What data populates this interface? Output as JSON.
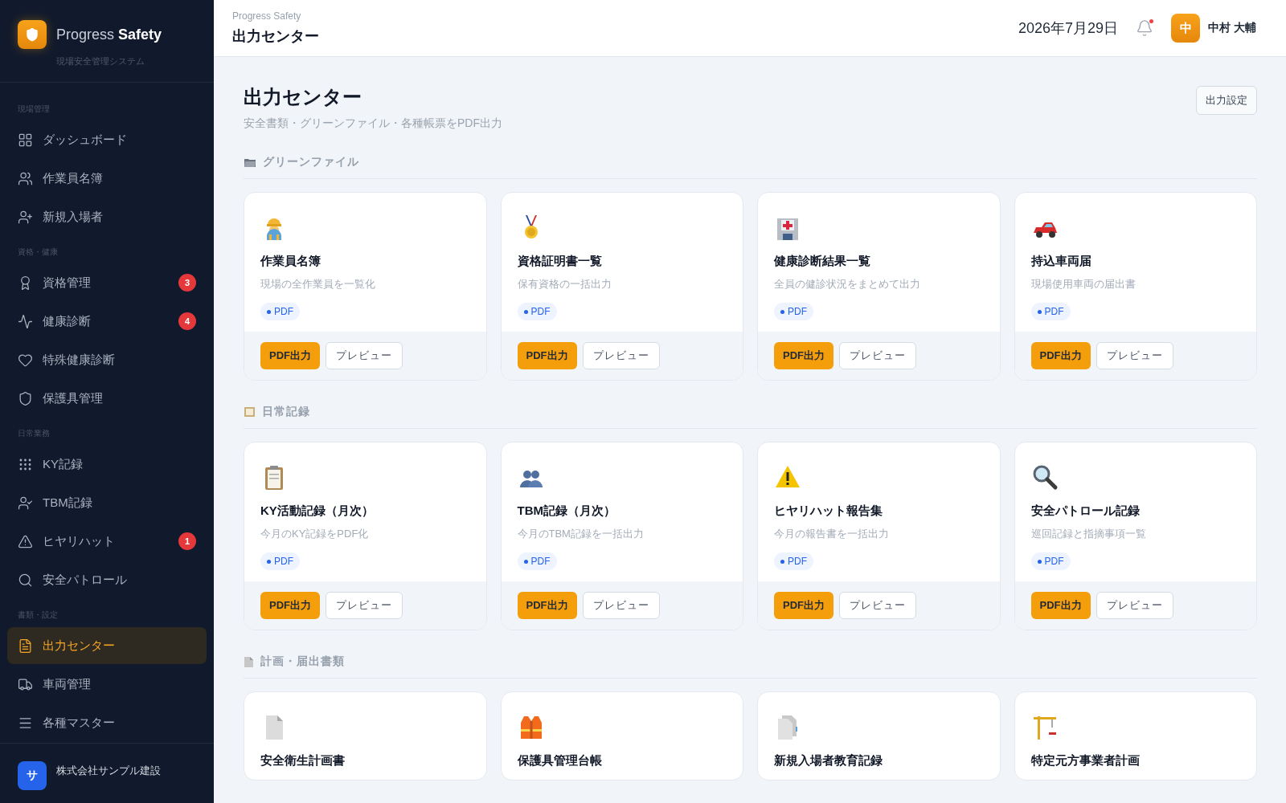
{
  "sidebar": {
    "brand": {
      "name_light": "Progress",
      "name_bold": "Safety",
      "tagline": "現場安全管理システム"
    },
    "groups": [
      {
        "label": "現場管理",
        "items": [
          {
            "label": "ダッシュボード",
            "selected": false
          },
          {
            "label": "作業員名簿",
            "selected": false
          },
          {
            "label": "新規入場者",
            "selected": false
          }
        ]
      },
      {
        "label": "資格・健康",
        "items": [
          {
            "label": "資格管理",
            "selected": false,
            "badge": "3"
          },
          {
            "label": "健康診断",
            "selected": false,
            "badge": "4"
          },
          {
            "label": "特殊健康診断",
            "selected": false
          },
          {
            "label": "保護具管理",
            "selected": false
          }
        ]
      },
      {
        "label": "日常業務",
        "items": [
          {
            "label": "KY記録",
            "selected": false
          },
          {
            "label": "TBM記録",
            "selected": false
          },
          {
            "label": "ヒヤリハット",
            "selected": false,
            "badge": "1"
          },
          {
            "label": "安全パトロール",
            "selected": false
          }
        ]
      },
      {
        "label": "書類・設定",
        "items": [
          {
            "label": "出力センター",
            "selected": true
          },
          {
            "label": "車両管理",
            "selected": false
          },
          {
            "label": "各種マスター",
            "selected": false
          }
        ]
      }
    ],
    "company": {
      "avatar": "サ",
      "name": "株式会社サンプル建設"
    }
  },
  "header": {
    "breadcrumb": "Progress Safety",
    "title": "出力センター",
    "date": "2026年7月29日",
    "notification": true,
    "user": {
      "avatar": "中",
      "name": "中村 大輔"
    }
  },
  "page": {
    "title": "出力センター",
    "subtitle": "安全書類・グリーンファイル・各種帳票をPDF出力",
    "settings_button": "出力設定"
  },
  "sections": [
    {
      "title": "グリーンファイル",
      "cards": [
        {
          "title": "作業員名簿",
          "description": "現場の全作業員を一覧化",
          "format": "PDF",
          "primary": "PDF出力",
          "secondary": "プレビュー"
        },
        {
          "title": "資格証明書一覧",
          "description": "保有資格の一括出力",
          "format": "PDF",
          "primary": "PDF出力",
          "secondary": "プレビュー"
        },
        {
          "title": "健康診断結果一覧",
          "description": "全員の健診状況をまとめて出力",
          "format": "PDF",
          "primary": "PDF出力",
          "secondary": "プレビュー"
        },
        {
          "title": "持込車両届",
          "description": "現場使用車両の届出書",
          "format": "PDF",
          "primary": "PDF出力",
          "secondary": "プレビュー"
        }
      ]
    },
    {
      "title": "日常記録",
      "cards": [
        {
          "title": "KY活動記録（月次）",
          "description": "今月のKY記録をPDF化",
          "format": "PDF",
          "primary": "PDF出力",
          "secondary": "プレビュー"
        },
        {
          "title": "TBM記録（月次）",
          "description": "今月のTBM記録を一括出力",
          "format": "PDF",
          "primary": "PDF出力",
          "secondary": "プレビュー"
        },
        {
          "title": "ヒヤリハット報告集",
          "description": "今月の報告書を一括出力",
          "format": "PDF",
          "primary": "PDF出力",
          "secondary": "プレビュー"
        },
        {
          "title": "安全パトロール記録",
          "description": "巡回記録と指摘事項一覧",
          "format": "PDF",
          "primary": "PDF出力",
          "secondary": "プレビュー"
        }
      ]
    },
    {
      "title": "計画・届出書類",
      "cards": [
        {
          "title": "安全衛生計画書"
        },
        {
          "title": "保護具管理台帳"
        },
        {
          "title": "新規入場者教育記録"
        },
        {
          "title": "特定元方事業者計画"
        }
      ]
    }
  ]
}
